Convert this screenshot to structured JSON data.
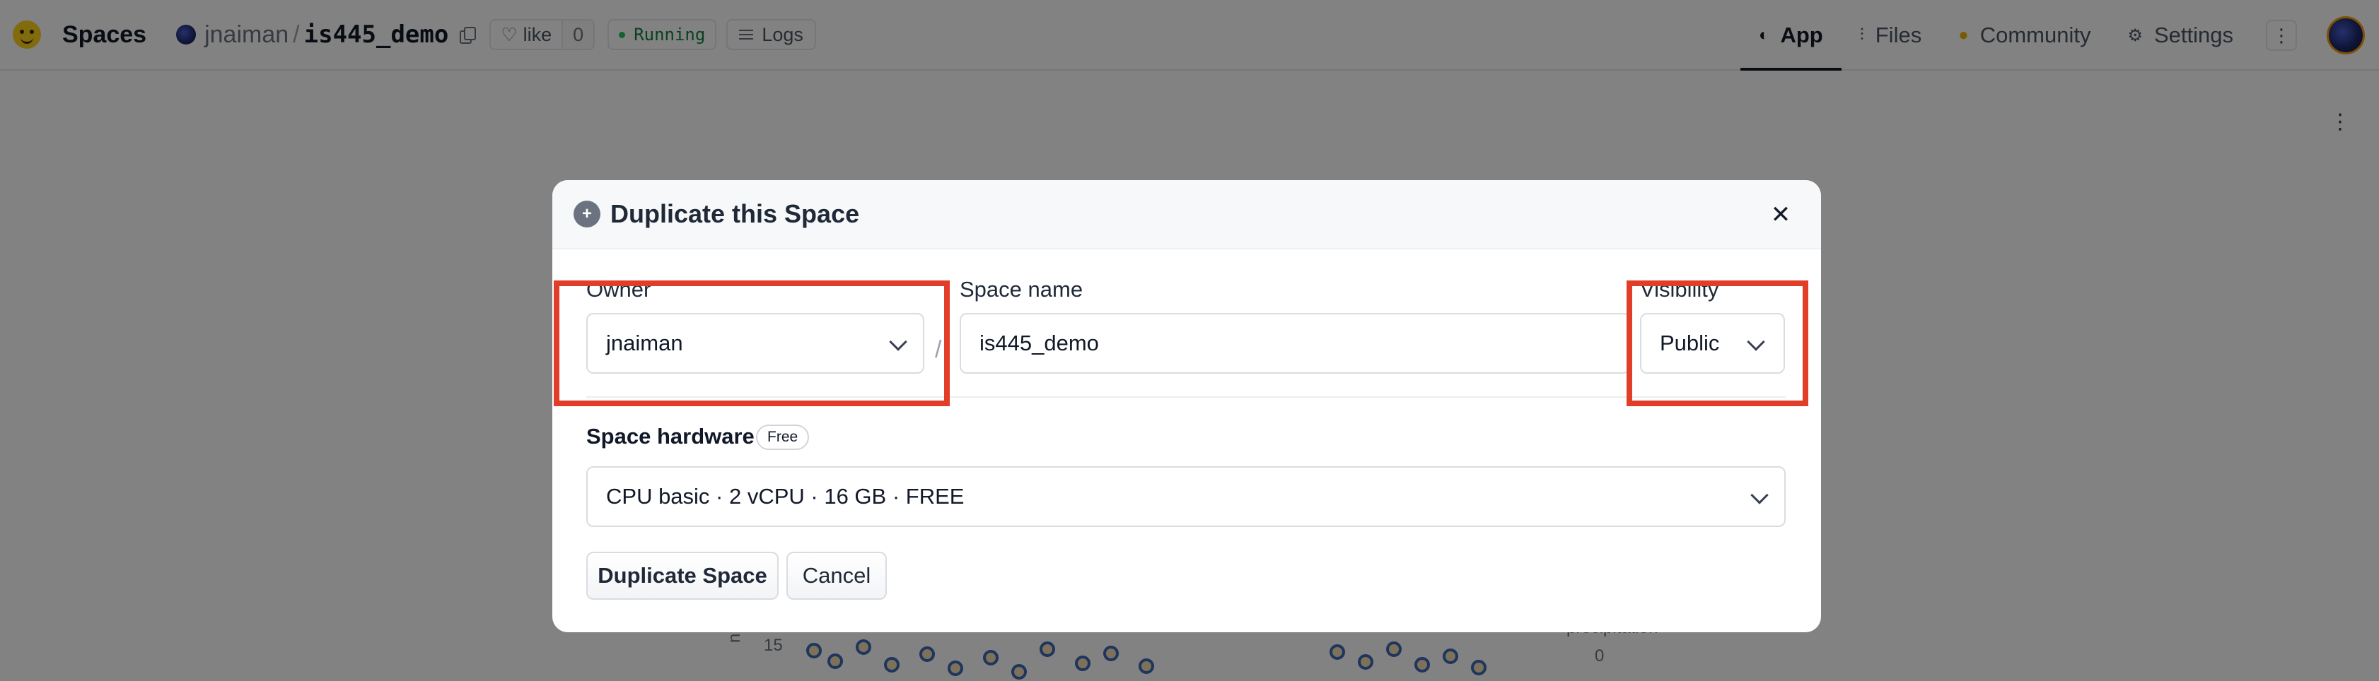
{
  "header": {
    "brand": "Spaces",
    "owner": "jnaiman",
    "separator": "/",
    "repo": "is445_demo",
    "like_label": "like",
    "like_count": "0",
    "status": "Running",
    "logs_label": "Logs",
    "nav": {
      "app": "App",
      "files": "Files",
      "community": "Community",
      "settings": "Settings"
    }
  },
  "background": {
    "axis_tick": "15",
    "axis_label_fragment": "n Dail",
    "legend_title": "precipitation",
    "legend_value": "0"
  },
  "modal": {
    "title": "Duplicate this Space",
    "owner_label": "Owner",
    "owner_value": "jnaiman",
    "separator": "/",
    "space_name_label": "Space name",
    "space_name_value": "is445_demo",
    "visibility_label": "Visibility",
    "visibility_value": "Public",
    "hardware_label": "Space hardware",
    "hardware_badge": "Free",
    "hardware_value": "CPU basic · 2 vCPU · 16 GB · FREE",
    "duplicate_button": "Duplicate Space",
    "cancel_button": "Cancel"
  },
  "colors": {
    "highlight": "#e23d28",
    "running": "#15803d",
    "overlay": "rgba(0,0,0,0.49)"
  }
}
